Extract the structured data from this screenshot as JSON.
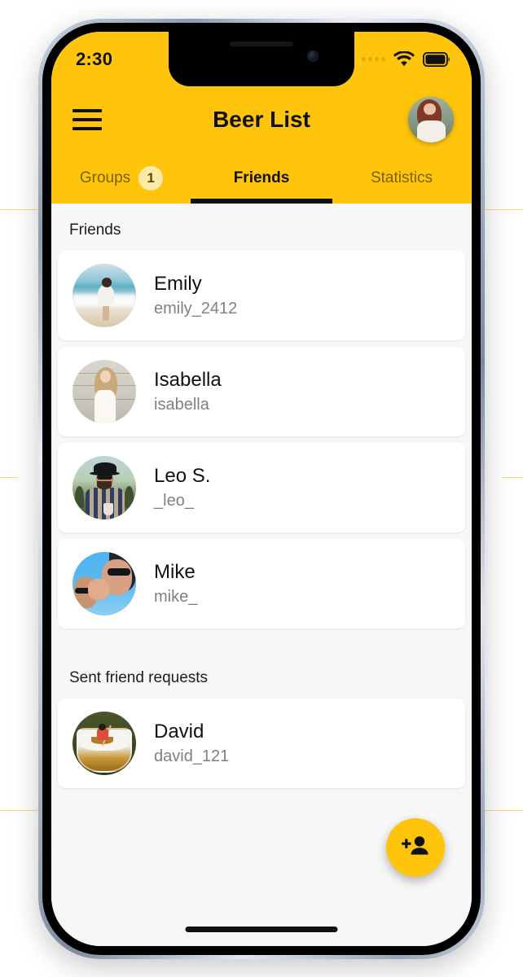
{
  "status_bar": {
    "time": "2:30",
    "signal_icon": "signal-dots-icon",
    "wifi_icon": "wifi-icon",
    "battery_icon": "battery-full-icon"
  },
  "app_bar": {
    "menu_icon": "hamburger-menu-icon",
    "title": "Beer List",
    "profile_avatar": "user-profile-avatar",
    "background_color": "#FFC40C"
  },
  "tabs": [
    {
      "label": "Groups",
      "badge": "1",
      "active": false
    },
    {
      "label": "Friends",
      "badge": "",
      "active": true
    },
    {
      "label": "Statistics",
      "badge": "",
      "active": false
    }
  ],
  "sections": [
    {
      "title": "Friends",
      "rows": [
        {
          "name": "Emily",
          "handle": "emily_2412",
          "avatar": "emily-avatar"
        },
        {
          "name": "Isabella",
          "handle": "isabella",
          "avatar": "isabella-avatar"
        },
        {
          "name": "Leo S.",
          "handle": "_leo_",
          "avatar": "leo-avatar"
        },
        {
          "name": "Mike",
          "handle": "mike_",
          "avatar": "mike-avatar"
        }
      ]
    },
    {
      "title": "Sent friend requests",
      "rows": [
        {
          "name": "David",
          "handle": "david_121",
          "avatar": "david-avatar"
        }
      ]
    }
  ],
  "fab": {
    "icon": "add-person-icon",
    "color": "#FFC40C"
  },
  "home_indicator": "home-indicator-bar"
}
